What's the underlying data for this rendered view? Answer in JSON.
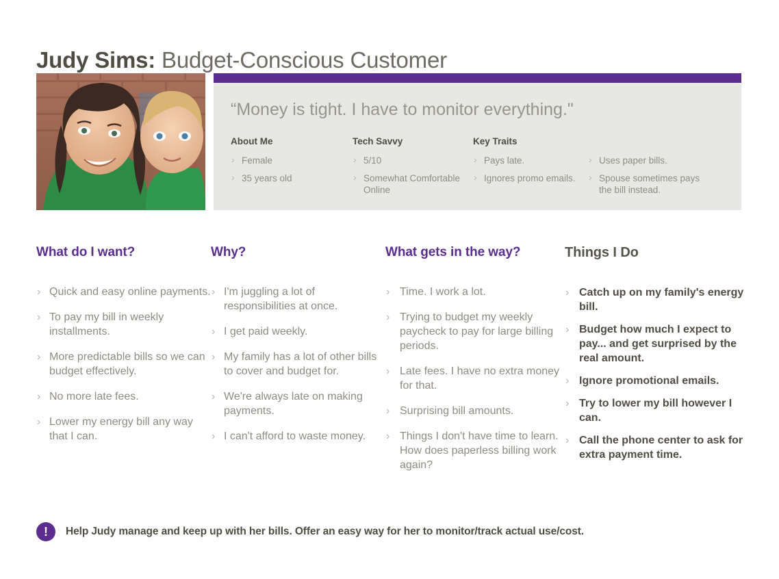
{
  "title": {
    "name": "Judy Sims:",
    "role": " Budget-Conscious Customer"
  },
  "colors": {
    "accent_purple": "#5B2D8E",
    "panel_gray": "#E7E7E3",
    "body_text": "#8D8B83",
    "heading_dark": "#4E4C43"
  },
  "photo": {
    "alt": "Photo of Judy Sims with her young son"
  },
  "panel": {
    "quote": "“Money is tight. I have to monitor everything.\"",
    "facts": [
      {
        "heading": "About Me",
        "items": [
          "Female",
          "35 years old"
        ]
      },
      {
        "heading": "Tech Savvy",
        "items": [
          "5/10",
          "Somewhat Comfortable Online"
        ]
      },
      {
        "heading": "Key Traits",
        "groups": [
          [
            "Pays late.",
            "Ignores promo emails."
          ],
          [
            "Uses paper bills.",
            "Spouse sometimes pays the bill instead."
          ]
        ]
      }
    ]
  },
  "columns": [
    {
      "heading": "What do I want?",
      "items": [
        "Quick and easy online payments.",
        "To pay my bill in weekly installments.",
        "More predictable bills so we can budget effectively.",
        "No more late fees.",
        "Lower my energy bill any way that I can."
      ]
    },
    {
      "heading": "Why?",
      "items": [
        "I'm juggling a lot of responsibilities at once.",
        "I get paid weekly.",
        "My family has a lot of other bills to cover and budget for.",
        "We're always late on making payments.",
        "I can't afford to waste money."
      ]
    },
    {
      "heading": "What gets in the way?",
      "items": [
        "Time. I work a lot.",
        "Trying to budget my weekly paycheck to pay for large billing periods.",
        "Late fees. I have no extra money for that.",
        "Surprising bill amounts.",
        "Things I don't have time to learn. How does paperless billing work again?"
      ]
    },
    {
      "heading": "Things I Do",
      "items": [
        "Catch up on my family's energy bill.",
        "Budget how much I expect to pay... and get surprised by the real amount.",
        "Ignore promotional emails.",
        "Try to lower my bill however I can.",
        "Call the phone center to ask for extra payment time."
      ]
    }
  ],
  "footer": {
    "icon": "exclamation-icon",
    "icon_glyph": "!",
    "text": "Help Judy manage and keep up with her bills. Offer an easy way for her to monitor/track actual use/cost."
  }
}
